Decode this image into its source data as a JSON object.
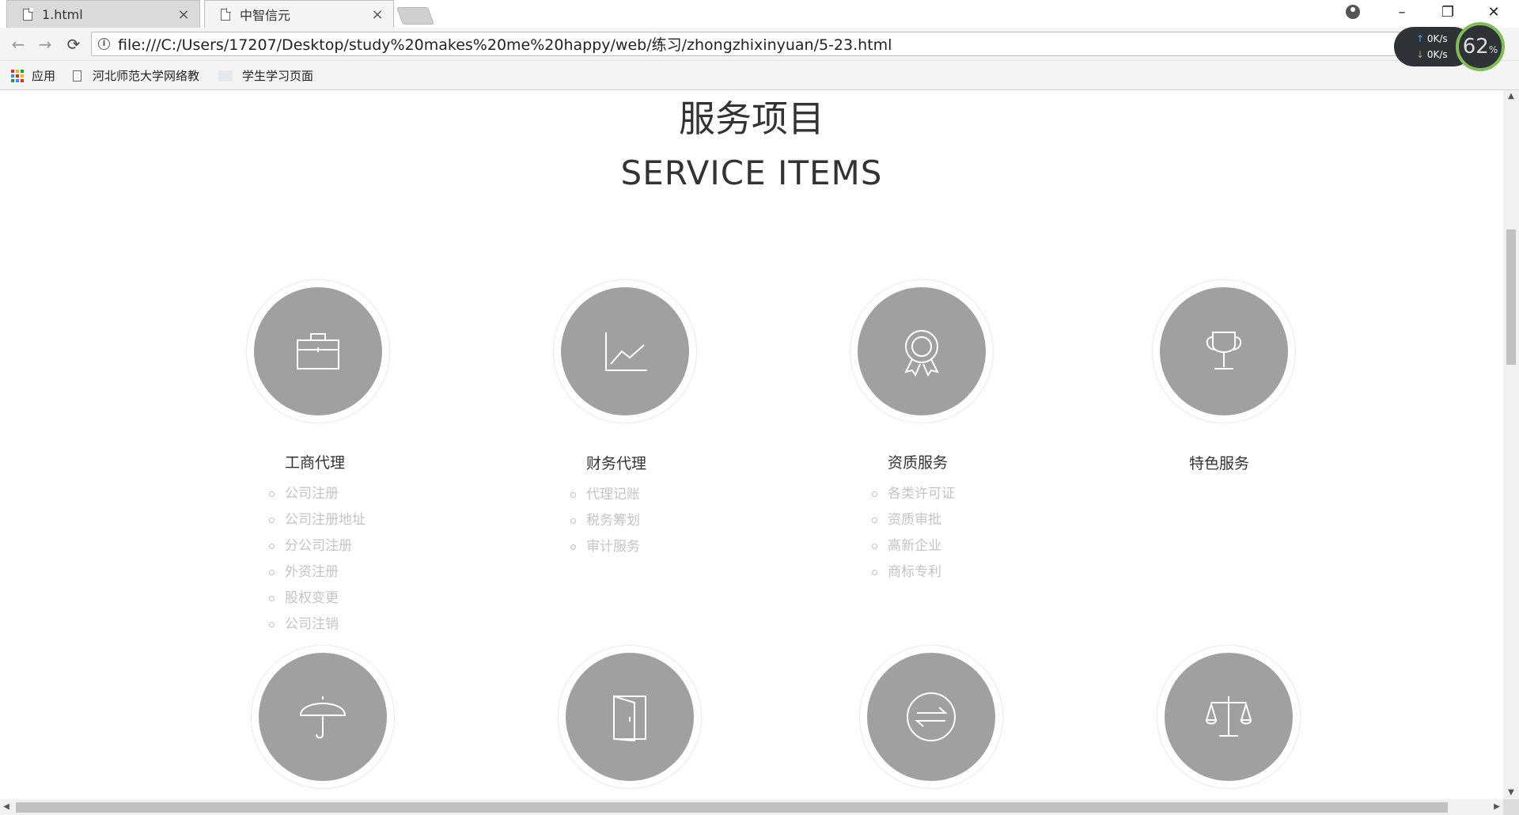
{
  "browser": {
    "tabs": [
      {
        "title": "1.html",
        "close": "×"
      },
      {
        "title": "中智信元",
        "close": "×"
      }
    ],
    "address": "file:///C:/Users/17207/Desktop/study%20makes%20me%20happy/web/练习/zhongzhixinyuan/5-23.html",
    "nav": {
      "back": "←",
      "forward": "→",
      "reload": "⟳",
      "info": "i"
    },
    "window_controls": {
      "minimize": "–",
      "restore": "❐",
      "close": "✕"
    },
    "bookmarks": [
      {
        "label": "应用",
        "icon": "apps-grid-icon"
      },
      {
        "label": "河北师范大学网络教",
        "icon": "page-icon"
      },
      {
        "label": "学生学习页面",
        "icon": "blank-favicon-icon"
      }
    ],
    "speed_widget": {
      "up": "0K/s",
      "down": "0K/s",
      "percent": "62",
      "percent_sign": "%",
      "accent": "#7fbe55"
    }
  },
  "page": {
    "section_title_cn": "服务项目",
    "section_title_en": "SERVICE ITEMS",
    "services": [
      {
        "title": "工商代理",
        "icon": "briefcase-icon",
        "items": [
          "公司注册",
          "公司注册地址",
          "分公司注册",
          "外资注册",
          "股权变更",
          "公司注销"
        ]
      },
      {
        "title": "财务代理",
        "icon": "line-chart-icon",
        "items": [
          "代理记账",
          "税务筹划",
          "审计服务"
        ]
      },
      {
        "title": "资质服务",
        "icon": "award-ribbon-icon",
        "items": [
          "各类许可证",
          "资质审批",
          "高新企业",
          "商标专利"
        ]
      },
      {
        "title": "特色服务",
        "icon": "trophy-icon",
        "items": []
      }
    ],
    "second_row_icons": [
      "umbrella-icon",
      "door-icon",
      "exchange-arrows-icon",
      "balance-scale-icon"
    ],
    "colors": {
      "circle": "#a0a0a0",
      "list_text": "#c4c4c4",
      "title_text": "#333333"
    }
  }
}
